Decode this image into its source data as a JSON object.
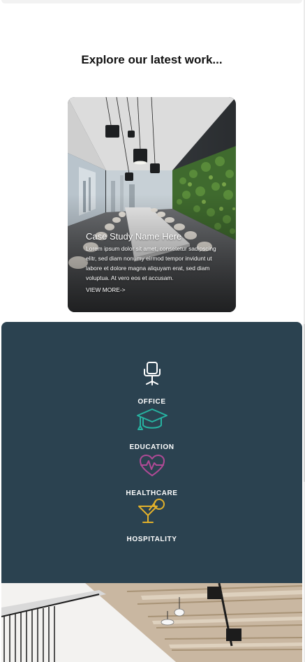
{
  "section": {
    "title": "Explore our latest work..."
  },
  "case_study": {
    "title": "Case Study Name Here",
    "description": "Lorem ipsum dolor sit amet, consetetur sadipscing elitr, sed diam nonumy eirmod tempor invidunt ut labore et dolore magna aliquyam erat, sed diam voluptua. At vero eos et accusam.",
    "link_label": "VIEW MORE->",
    "image": "conference-room-photo"
  },
  "sectors": {
    "background": "#2b4250",
    "items": [
      {
        "label": "OFFICE",
        "icon": "office-chair-icon",
        "color": "#ffffff"
      },
      {
        "label": "EDUCATION",
        "icon": "graduation-cap-icon",
        "color": "#27b3a1"
      },
      {
        "label": "HEALTHCARE",
        "icon": "heart-pulse-icon",
        "color": "#b04a96"
      },
      {
        "label": "HOSPITALITY",
        "icon": "cocktail-glass-icon",
        "color": "#e3b12a"
      }
    ]
  },
  "bottom_image": "office-interior-photo"
}
